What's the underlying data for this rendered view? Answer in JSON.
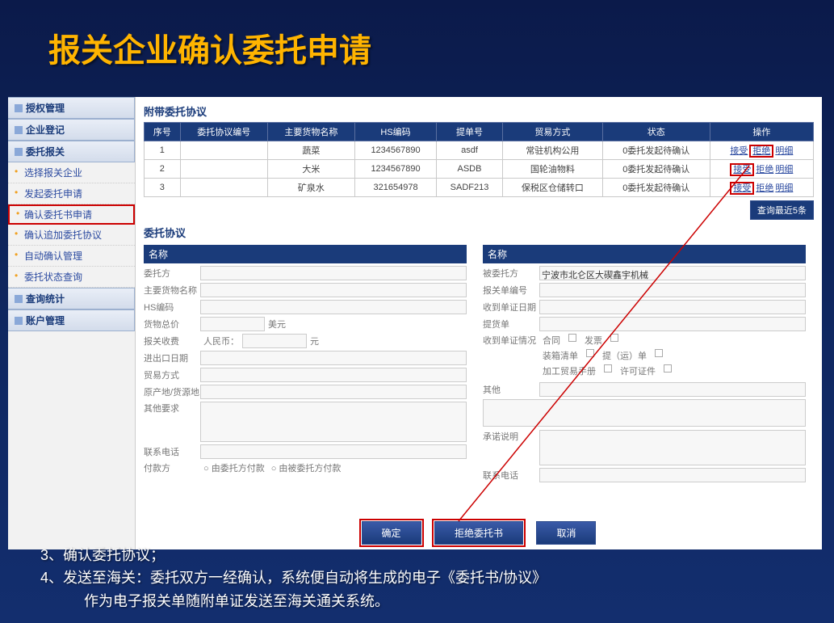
{
  "slide_title": "报关企业确认委托申请",
  "sidebar": {
    "sections": [
      {
        "label": "授权管理"
      },
      {
        "label": "企业登记"
      },
      {
        "label": "委托报关",
        "children": [
          {
            "label": "选择报关企业"
          },
          {
            "label": "发起委托申请"
          },
          {
            "label": "确认委托书申请",
            "active": true
          },
          {
            "label": "确认追加委托协议"
          },
          {
            "label": "自动确认管理"
          },
          {
            "label": "委托状态查询"
          }
        ]
      },
      {
        "label": "查询统计"
      },
      {
        "label": "账户管理"
      }
    ]
  },
  "upper_section_title": "附带委托协议",
  "columns": [
    "序号",
    "委托协议编号",
    "主要货物名称",
    "HS编码",
    "提单号",
    "贸易方式",
    "状态",
    "操作"
  ],
  "rows": [
    {
      "no": "1",
      "agr": "",
      "goods": "蔬菜",
      "hs": "1234567890",
      "bill": "asdf",
      "trade": "常驻机构公用",
      "status": "0委托发起待确认",
      "op_accept": "接受",
      "op_reject": "拒绝",
      "op_detail": "明细",
      "hi": "reject"
    },
    {
      "no": "2",
      "agr": "",
      "goods": "大米",
      "hs": "1234567890",
      "bill": "ASDB",
      "trade": "国轮油物料",
      "status": "0委托发起待确认",
      "op_accept": "接受",
      "op_reject": "拒绝",
      "op_detail": "明细",
      "hi": "accept"
    },
    {
      "no": "3",
      "agr": "",
      "goods": "矿泉水",
      "hs": "321654978",
      "bill": "SADF213",
      "trade": "保税区仓储转口",
      "status": "0委托发起待确认",
      "op_accept": "接受",
      "op_reject": "拒绝",
      "op_detail": "明细",
      "hi": "accept"
    }
  ],
  "recent_btn": "查询最近5条",
  "lower_section_title": "委托协议",
  "left_header": "名称",
  "right_header": "名称",
  "left_fields": {
    "f1": "委托方",
    "f2": "主要货物名称",
    "f3": "HS编码",
    "f4": "货物总价",
    "f4_unit": "美元",
    "f5": "报关收费",
    "f5_prefix": "人民币：",
    "f5_unit": "元",
    "f6": "进出口日期",
    "f7": "贸易方式",
    "f8": "原产地/货源地",
    "f9": "其他要求",
    "f10": "联系电话",
    "f11": "付款方",
    "f11_opt1": "由委托方付款",
    "f11_opt2": "由被委托方付款"
  },
  "right_fields": {
    "f1": "被委托方",
    "f1_val": "宁波市北仑区大碶鑫宇机械",
    "f2": "报关单编号",
    "f3": "收到单证日期",
    "f4": "提货单",
    "doc_label": "收到单证情况",
    "d1": "合同",
    "d2": "发票",
    "d3": "装箱清单",
    "d4": "提（运）单",
    "d5": "加工贸易手册",
    "d6": "许可证件",
    "other": "其他",
    "note": "承诺说明",
    "phone": "联系电话"
  },
  "buttons": {
    "confirm": "确定",
    "reject": "拒绝委托书",
    "cancel": "取消"
  },
  "notes": {
    "l1": "3、确认委托协议；",
    "l2": "4、发送至海关：委托双方一经确认，系统便自动将生成的电子《委托书/协议》",
    "l3": "作为电子报关单随附单证发送至海关通关系统。"
  }
}
